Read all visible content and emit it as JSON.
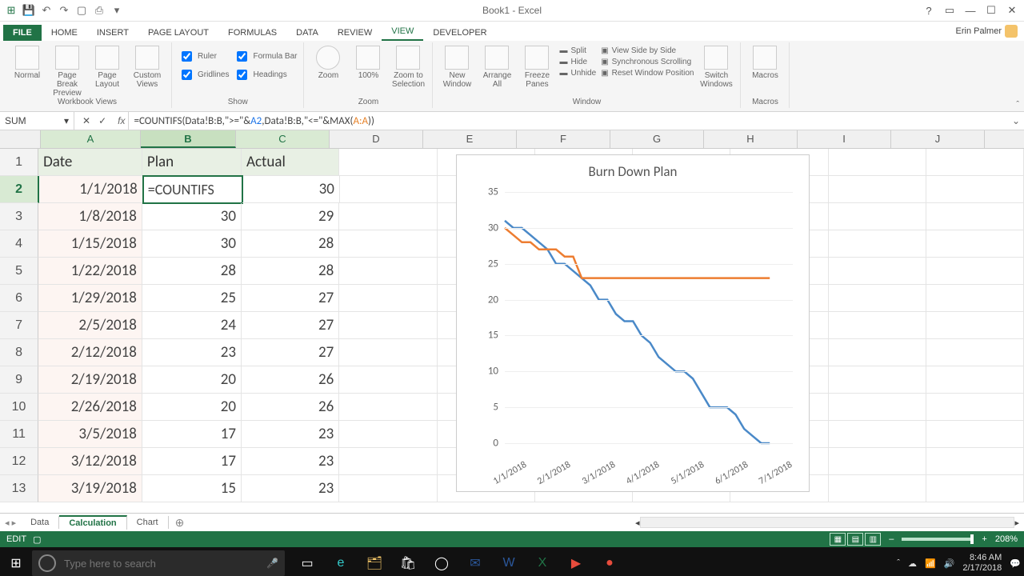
{
  "title": "Book1 - Excel",
  "user": "Erin Palmer",
  "qat": [
    "save",
    "undo",
    "redo",
    "new",
    "print-preview"
  ],
  "ribbon_tabs": [
    "FILE",
    "HOME",
    "INSERT",
    "PAGE LAYOUT",
    "FORMULAS",
    "DATA",
    "REVIEW",
    "VIEW",
    "DEVELOPER"
  ],
  "active_tab": "VIEW",
  "ribbon": {
    "views": {
      "label": "Workbook Views",
      "items": [
        "Normal",
        "Page Break Preview",
        "Page Layout",
        "Custom Views"
      ]
    },
    "show": {
      "label": "Show",
      "checks": [
        [
          "Ruler",
          true
        ],
        [
          "Formula Bar",
          true
        ],
        [
          "Gridlines",
          true
        ],
        [
          "Headings",
          true
        ]
      ]
    },
    "zoom": {
      "label": "Zoom",
      "items": [
        "Zoom",
        "100%",
        "Zoom to Selection"
      ]
    },
    "window": {
      "label": "Window",
      "big": [
        "New Window",
        "Arrange All",
        "Freeze Panes"
      ],
      "small": [
        "Split",
        "Hide",
        "Unhide",
        "View Side by Side",
        "Synchronous Scrolling",
        "Reset Window Position"
      ],
      "switch": "Switch Windows"
    },
    "macros": {
      "label": "Macros",
      "item": "Macros"
    }
  },
  "namebox": "SUM",
  "formula": {
    "pre": "=COUNTIFS(Data!B:B,\">=\"&",
    "ref1": "A2",
    "mid": ",Data!B:B,\"<=\"&MAX(",
    "ref2": "A:A",
    "post": "))"
  },
  "columns": [
    "A",
    "B",
    "C",
    "D",
    "E",
    "F",
    "G",
    "H",
    "I",
    "J"
  ],
  "headers": {
    "A": "Date",
    "B": "Plan",
    "C": "Actual"
  },
  "editing_cell_display": "=COUNTIFS",
  "rows": [
    {
      "n": 1
    },
    {
      "n": 2,
      "A": "1/1/2018",
      "B_edit": true,
      "C": "30"
    },
    {
      "n": 3,
      "A": "1/8/2018",
      "B": "30",
      "C": "29"
    },
    {
      "n": 4,
      "A": "1/15/2018",
      "B": "30",
      "C": "28"
    },
    {
      "n": 5,
      "A": "1/22/2018",
      "B": "28",
      "C": "28"
    },
    {
      "n": 6,
      "A": "1/29/2018",
      "B": "25",
      "C": "27"
    },
    {
      "n": 7,
      "A": "2/5/2018",
      "B": "24",
      "C": "27"
    },
    {
      "n": 8,
      "A": "2/12/2018",
      "B": "23",
      "C": "27"
    },
    {
      "n": 9,
      "A": "2/19/2018",
      "B": "20",
      "C": "26"
    },
    {
      "n": 10,
      "A": "2/26/2018",
      "B": "20",
      "C": "26"
    },
    {
      "n": 11,
      "A": "3/5/2018",
      "B": "17",
      "C": "23"
    },
    {
      "n": 12,
      "A": "3/12/2018",
      "B": "17",
      "C": "23"
    },
    {
      "n": 13,
      "A": "3/19/2018",
      "B": "15",
      "C": "23"
    }
  ],
  "sheet_tabs": [
    "Data",
    "Calculation",
    "Chart"
  ],
  "active_sheet": "Calculation",
  "status_mode": "EDIT",
  "zoom": "208%",
  "taskbar": {
    "search_placeholder": "Type here to search",
    "time": "8:46 AM",
    "date": "2/17/2018"
  },
  "chart_data": {
    "type": "line",
    "title": "Burn Down Plan",
    "xlabel": "",
    "ylabel": "",
    "ylim": [
      0,
      35
    ],
    "yticks": [
      0,
      5,
      10,
      15,
      20,
      25,
      30,
      35
    ],
    "x_categories": [
      "1/1/2018",
      "2/1/2018",
      "3/1/2018",
      "4/1/2018",
      "5/1/2018",
      "6/1/2018",
      "7/1/2018"
    ],
    "series": [
      {
        "name": "Plan",
        "color": "#4a89c8",
        "values": [
          31,
          30,
          30,
          29,
          28,
          27,
          25,
          25,
          24,
          23,
          22,
          20,
          20,
          18,
          17,
          17,
          15,
          14,
          12,
          11,
          10,
          10,
          9,
          7,
          5,
          5,
          5,
          4,
          2,
          1,
          0,
          0
        ]
      },
      {
        "name": "Actual",
        "color": "#ed7d31",
        "values": [
          30,
          29,
          28,
          28,
          27,
          27,
          27,
          26,
          26,
          23,
          23,
          23,
          23,
          23,
          23,
          23,
          23,
          23,
          23,
          23,
          23,
          23,
          23,
          23,
          23,
          23,
          23,
          23,
          23,
          23,
          23,
          23
        ]
      }
    ]
  }
}
